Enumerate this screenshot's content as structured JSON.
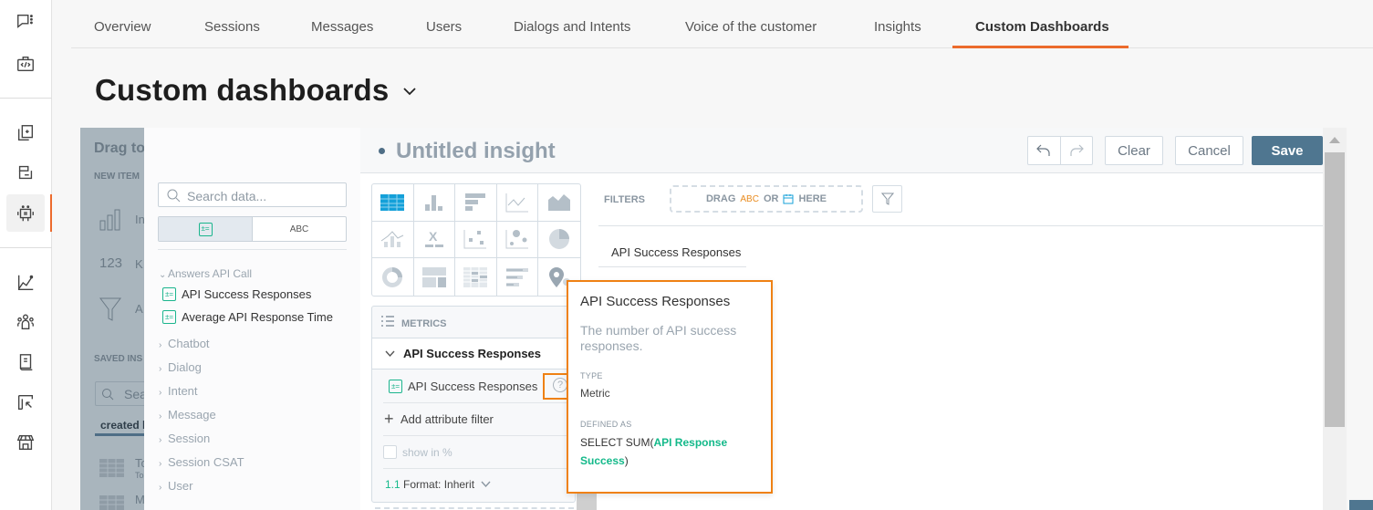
{
  "rail": {
    "icons": [
      "chat-menu-icon",
      "code-bag-icon",
      "copy-document-icon",
      "channel-icon",
      "bot-icon",
      "analytics-icon",
      "people-icon",
      "book-icon",
      "cursor-frame-icon",
      "store-icon"
    ],
    "active": "bot-icon"
  },
  "tabs": [
    {
      "label": "Overview"
    },
    {
      "label": "Sessions"
    },
    {
      "label": "Messages"
    },
    {
      "label": "Users"
    },
    {
      "label": "Dialogs and Intents"
    },
    {
      "label": "Voice of the customer"
    },
    {
      "label": "Insights"
    },
    {
      "label": "Custom Dashboards",
      "active": true
    }
  ],
  "page": {
    "title": "Custom dashboards"
  },
  "background_panel": {
    "heading": "Drag to",
    "new_items_label": "NEW ITEM",
    "new_items": [
      "In",
      "K",
      "A"
    ],
    "saved_label": "SAVED INS",
    "search_placeholder": "Sea",
    "tab_label": "created l",
    "saved_items": [
      {
        "title": "To",
        "sub": "To"
      },
      {
        "title": "M"
      }
    ]
  },
  "editor": {
    "title": "Untitled insight",
    "buttons": {
      "clear": "Clear",
      "cancel": "Cancel",
      "save": "Save"
    },
    "search_placeholder": "Search data...",
    "segment": {
      "metrics_icon": "metric-icon",
      "attributes_label": "ABC"
    },
    "tree": [
      {
        "label": "Answers API Call",
        "expanded": true,
        "children": [
          "API Success Responses",
          "Average API Response Time"
        ]
      },
      {
        "label": "Chatbot"
      },
      {
        "label": "Dialog"
      },
      {
        "label": "Intent"
      },
      {
        "label": "Message"
      },
      {
        "label": "Session"
      },
      {
        "label": "Session CSAT"
      },
      {
        "label": "User"
      }
    ],
    "chart_types": [
      "table",
      "column",
      "bar",
      "line",
      "area",
      "combo",
      "headline",
      "scatter",
      "bubble",
      "pie",
      "donut",
      "treemap",
      "heatmap",
      "bullet",
      "geo"
    ],
    "metrics": {
      "label": "METRICS",
      "card_title": "API Success Responses",
      "item": "API Success Responses",
      "add_filter": "Add attribute filter",
      "show_pct": "show in %",
      "format_prefix": "1.1",
      "format": "Format: Inherit"
    },
    "filters": {
      "label": "FILTERS",
      "drop_drag": "DRAG",
      "drop_abc": "ABC",
      "drop_or": "OR",
      "drop_here": "HERE"
    },
    "column_header": "API Success Responses"
  },
  "tooltip": {
    "title": "API Success Responses",
    "description": "The number of API success responses.",
    "type_label": "TYPE",
    "type_value": "Metric",
    "defined_label": "DEFINED AS",
    "defined_prefix": "SELECT SUM(",
    "defined_highlight": "API Response Success",
    "defined_suffix": ")"
  },
  "colors": {
    "accent": "#ec6b2d",
    "save": "#4f7690",
    "highlight": "#ef8114",
    "metric_green": "#14b98a"
  }
}
